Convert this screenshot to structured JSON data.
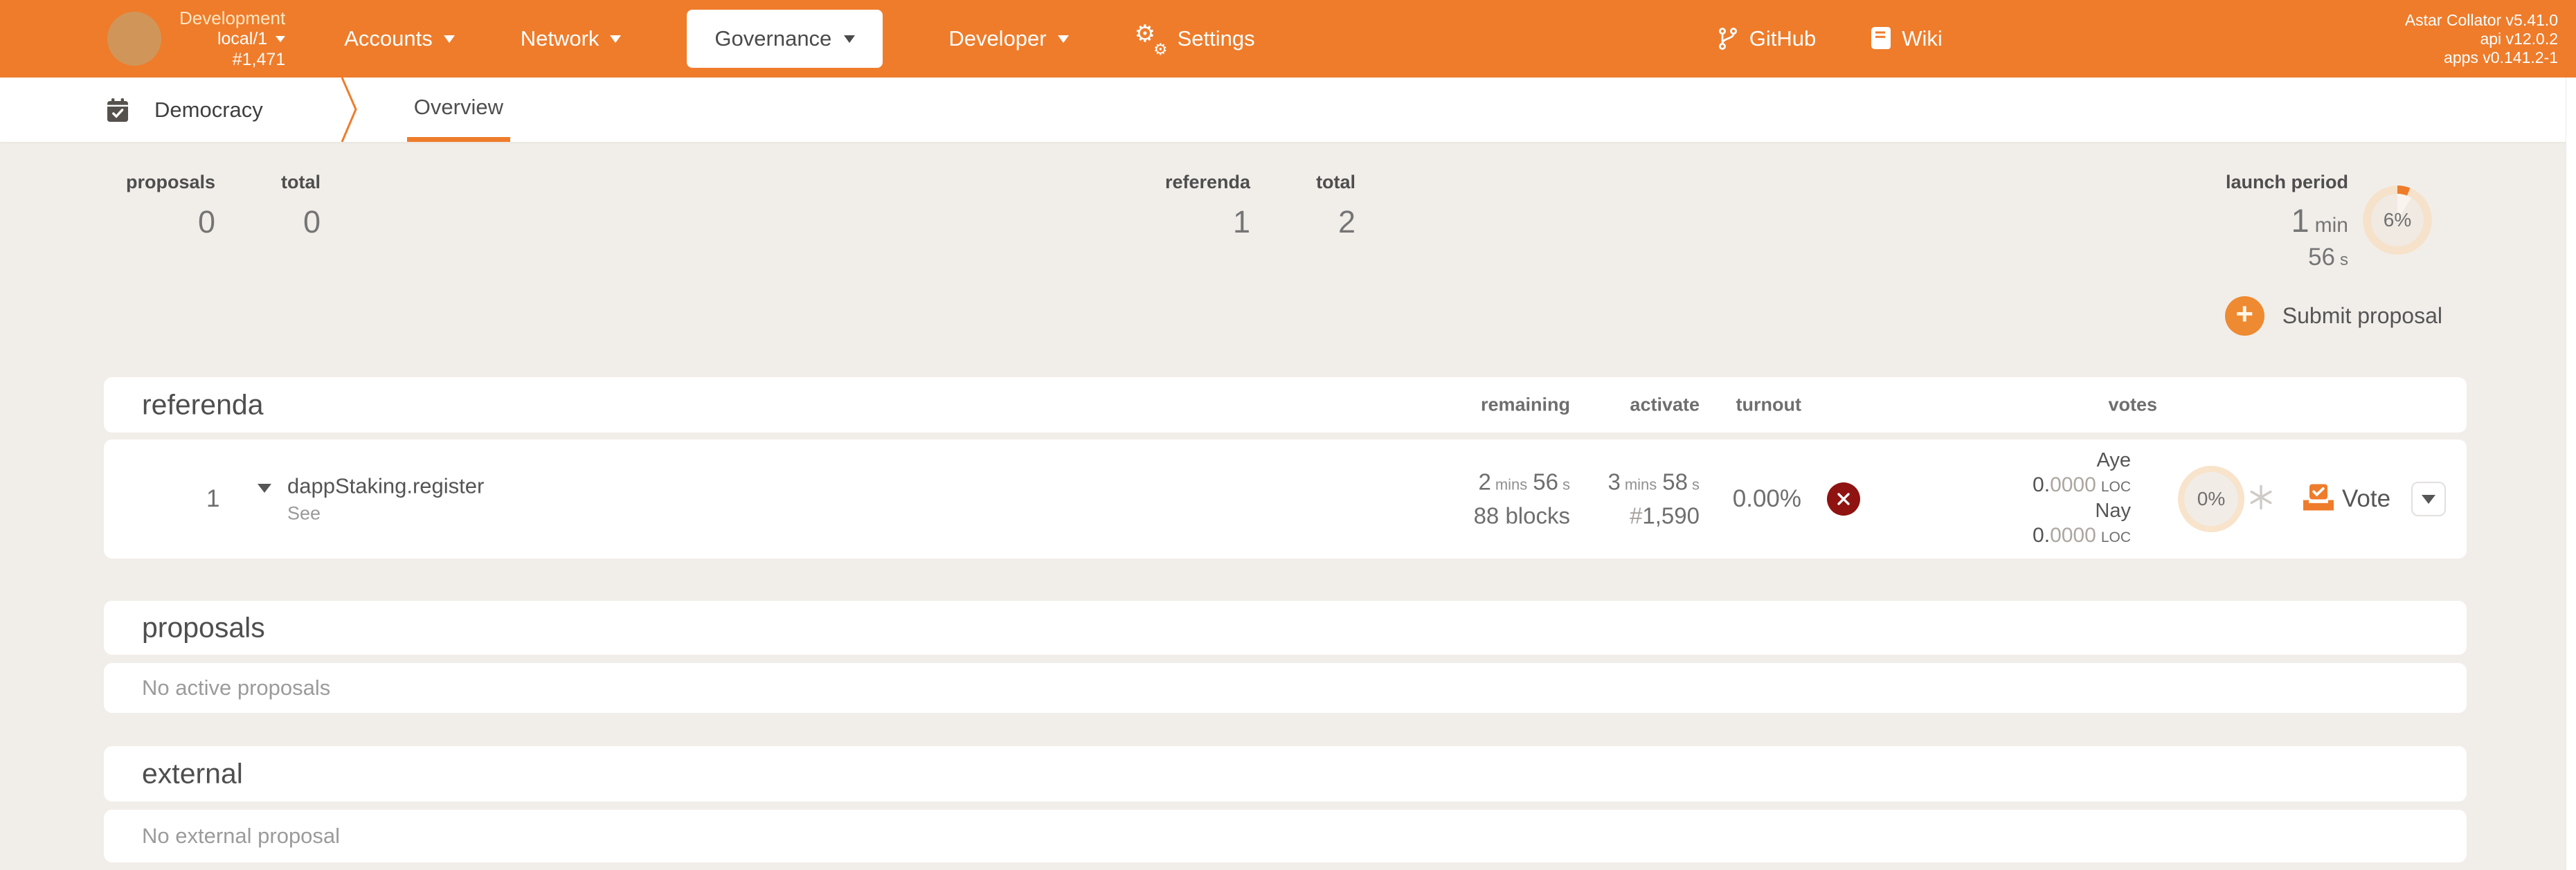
{
  "header": {
    "chain": {
      "name": "Development",
      "node": "local/1",
      "block": "#1,471"
    },
    "nav": [
      {
        "label": "Accounts"
      },
      {
        "label": "Network"
      },
      {
        "label": "Governance"
      },
      {
        "label": "Developer"
      },
      {
        "label": "Settings"
      }
    ],
    "links": [
      {
        "label": "GitHub"
      },
      {
        "label": "Wiki"
      }
    ],
    "version": {
      "line1": "Astar Collator v5.41.0",
      "line2": "api v12.0.2",
      "line3": "apps v0.141.2-1"
    }
  },
  "breadcrumb": {
    "section": "Democracy",
    "tab": "Overview"
  },
  "summary": {
    "proposals": {
      "label": "proposals",
      "value": "0"
    },
    "proposals_total": {
      "label": "total",
      "value": "0"
    },
    "referenda": {
      "label": "referenda",
      "value": "1"
    },
    "referenda_total": {
      "label": "total",
      "value": "2"
    },
    "launch": {
      "label": "launch period",
      "num": "1",
      "unit": "min",
      "sub_num": "56",
      "sub_unit": "s",
      "progress": "6%"
    }
  },
  "actions": {
    "submit_proposal": "Submit proposal"
  },
  "referenda_table": {
    "title": "referenda",
    "columns": {
      "remaining": "remaining",
      "activate": "activate",
      "turnout": "turnout",
      "votes": "votes"
    },
    "row": {
      "id": "1",
      "method": "dappStaking.register",
      "link": "See",
      "remaining_n1": "2",
      "remaining_u1": "mins",
      "remaining_n2": "56",
      "remaining_u2": "s",
      "remaining_blocks": "88 blocks",
      "activate_n1": "3",
      "activate_u1": "mins",
      "activate_n2": "58",
      "activate_u2": "s",
      "activate_hash": "#",
      "activate_block": "1,590",
      "turnout": "0.00%",
      "aye_label": "Aye",
      "aye_int": "0.",
      "aye_frac": "0000",
      "aye_unit": "LOC",
      "nay_label": "Nay",
      "nay_int": "0.",
      "nay_frac": "0000",
      "nay_unit": "LOC",
      "support_percent": "0%",
      "vote_label": "Vote"
    }
  },
  "proposals_section": {
    "title": "proposals",
    "empty": "No active proposals"
  },
  "external_section": {
    "title": "external",
    "empty": "No external proposal"
  },
  "colors": {
    "accent": "#ee7c2b",
    "danger": "#8f1310",
    "page_bg": "#f1eeea"
  }
}
